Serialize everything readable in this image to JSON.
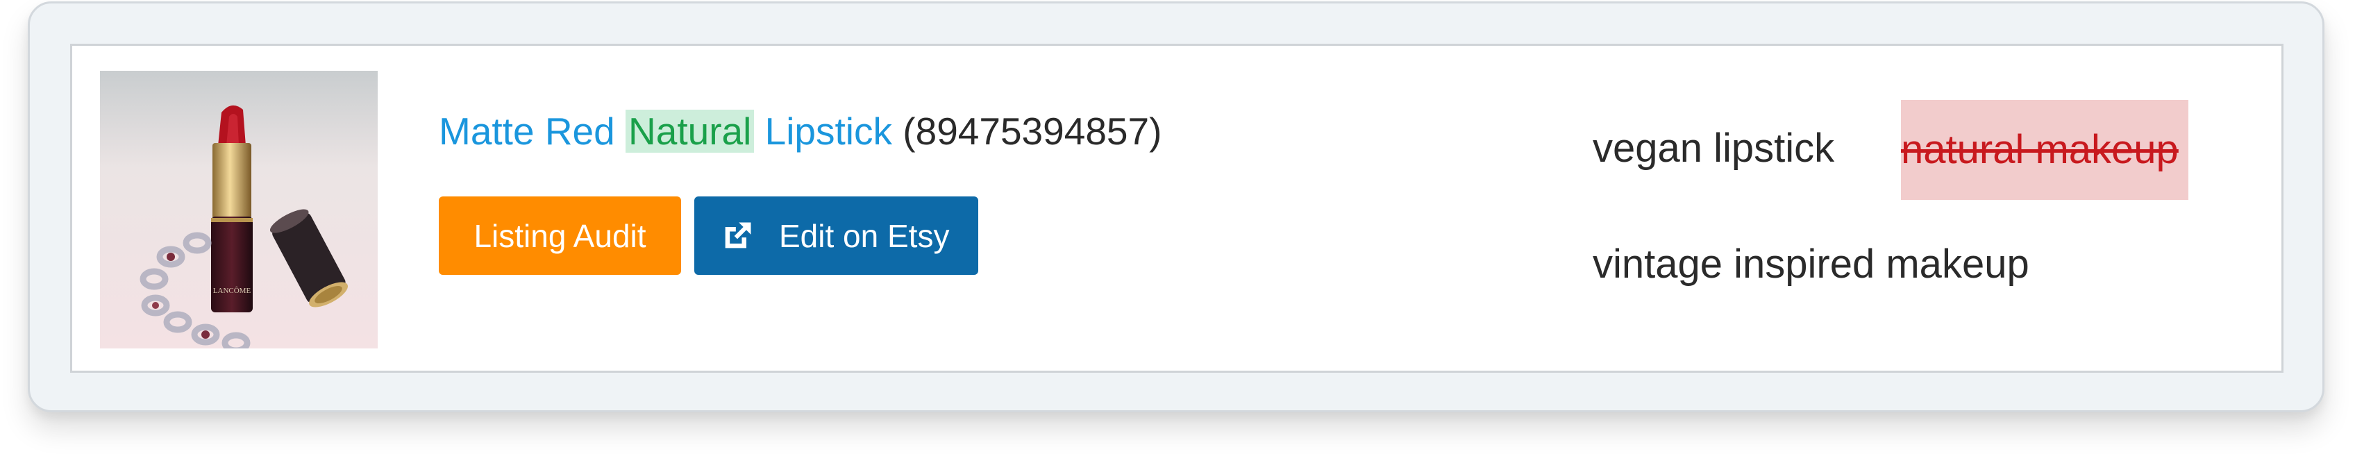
{
  "listing": {
    "title_part1": "Matte Red ",
    "title_highlight": "Natural",
    "title_part2": " Lipstick",
    "listing_id": "(89475394857)",
    "image_icon": "product-photo-lipstick"
  },
  "actions": {
    "audit_label": "Listing Audit",
    "edit_label": "Edit on Etsy",
    "edit_icon": "external-link-icon"
  },
  "tags": {
    "items": [
      "vegan lipstick",
      "natural makeup",
      "vintage inspired makeup"
    ],
    "removed_tag": "natural makeup"
  },
  "colors": {
    "link_blue": "#1a96dd",
    "highlight_green": "#1aa04a",
    "highlight_bg": "#cdeedb",
    "audit_orange": "#ff8c00",
    "etsy_blue": "#0d6aa8",
    "removed_red": "#c8191e",
    "removed_bg": "#f2cccc"
  }
}
